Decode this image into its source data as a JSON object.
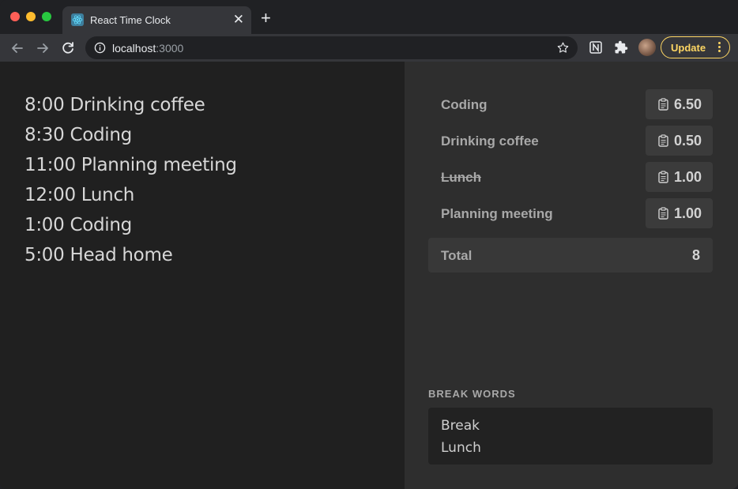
{
  "browser": {
    "tab_title": "React Time Clock",
    "url_host": "localhost",
    "url_port": ":3000",
    "update_label": "Update",
    "update_color": "#fdd663"
  },
  "entries": [
    "8:00 Drinking coffee",
    "8:30 Coding",
    "11:00 Planning meeting",
    "12:00 Lunch",
    "1:00 Coding",
    "5:00 Head home"
  ],
  "summary": {
    "rows": [
      {
        "label": "Coding",
        "value": "6.50",
        "struck": false,
        "icon": "clipboard-icon"
      },
      {
        "label": "Drinking coffee",
        "value": "0.50",
        "struck": false,
        "icon": "clipboard-icon"
      },
      {
        "label": "Lunch",
        "value": "1.00",
        "struck": true,
        "icon": "clipboard-icon"
      },
      {
        "label": "Planning meeting",
        "value": "1.00",
        "struck": false,
        "icon": "clipboard-icon"
      }
    ],
    "total_label": "Total",
    "total_value": "8"
  },
  "break_words": {
    "heading": "BREAK WORDS",
    "lines": [
      "Break",
      "Lunch"
    ]
  }
}
